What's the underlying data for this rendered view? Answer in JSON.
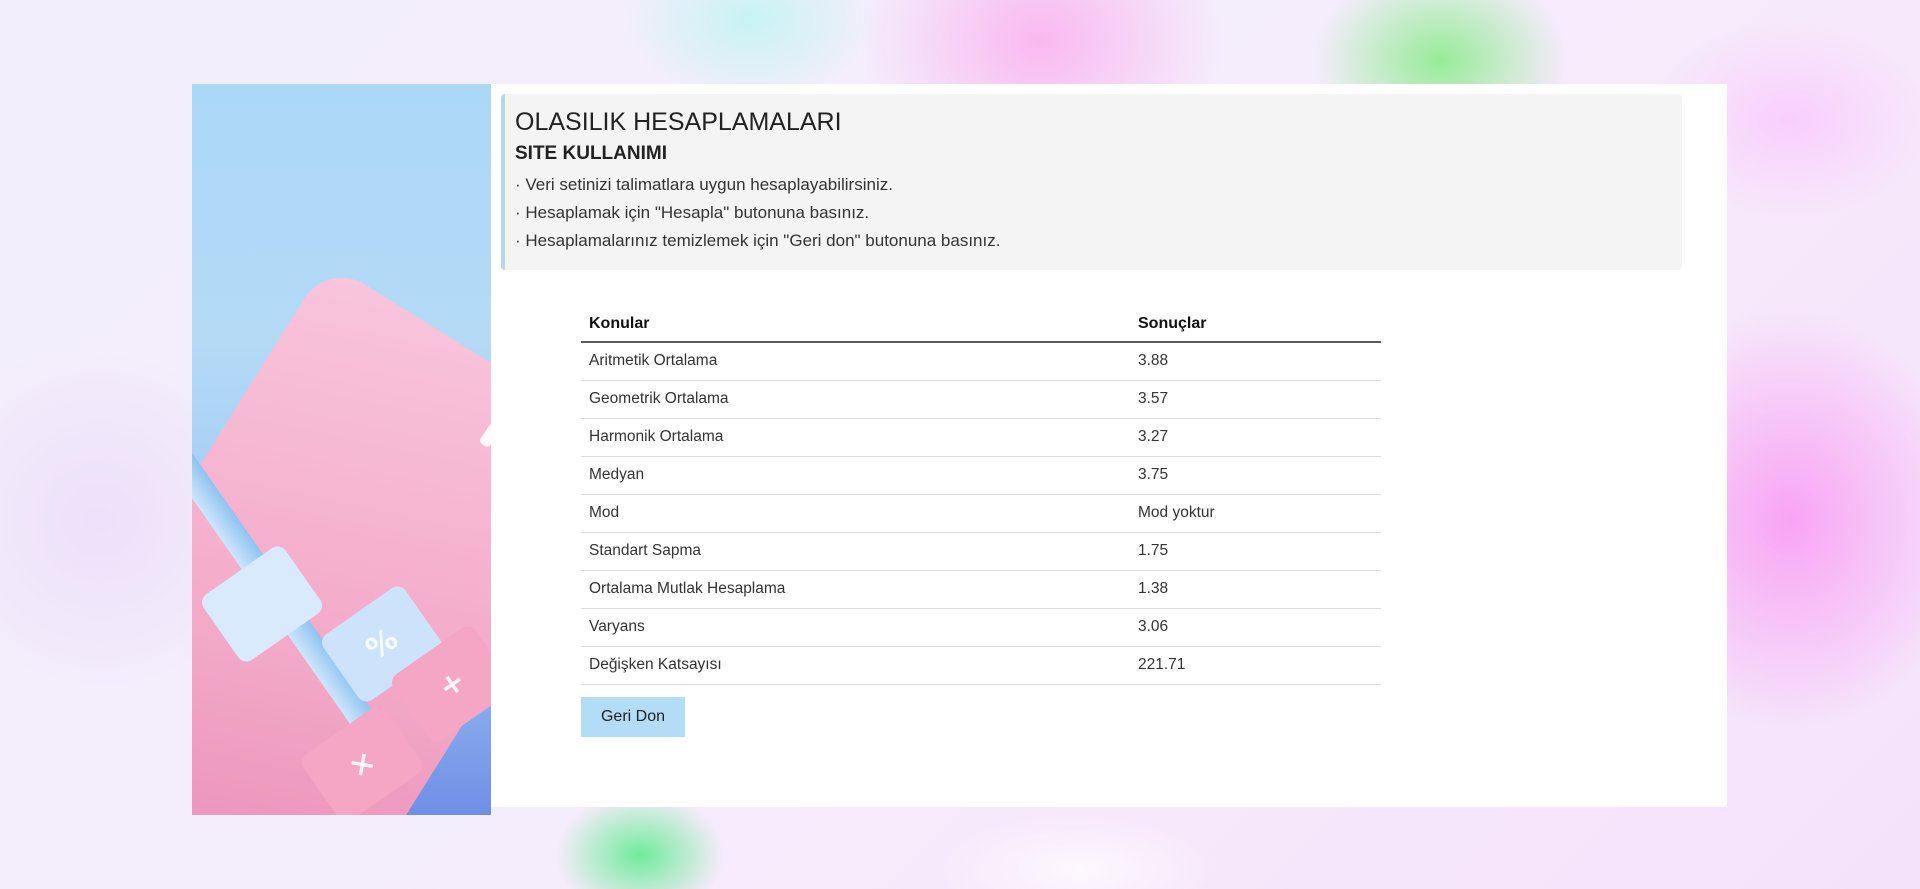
{
  "info": {
    "title": "OLASILIK HESAPLAMALARI",
    "subtitle": "SITE KULLANIMI",
    "lines": [
      "· Veri setinizi talimatlara uygun hesaplayabilirsiniz.",
      "· Hesaplamak için \"Hesapla\" butonuna basınız.",
      "· Hesaplamalarınız temizlemek için \"Geri don\" butonuna basınız."
    ]
  },
  "table": {
    "headers": [
      "Konular",
      "Sonuçlar"
    ],
    "rows": [
      [
        "Aritmetik Ortalama",
        "3.88"
      ],
      [
        "Geometrik Ortalama",
        "3.57"
      ],
      [
        "Harmonik Ortalama",
        "3.27"
      ],
      [
        "Medyan",
        "3.75"
      ],
      [
        "Mod",
        "Mod yoktur"
      ],
      [
        "Standart Sapma",
        "1.75"
      ],
      [
        "Ortalama Mutlak Hesaplama",
        "1.38"
      ],
      [
        "Varyans",
        "3.06"
      ],
      [
        "Değişken Katsayısı",
        "221.71"
      ]
    ]
  },
  "back_button": {
    "label": "Geri Don"
  },
  "side_image": {
    "key_symbols": [
      "%",
      "+",
      "×",
      "="
    ]
  },
  "colors": {
    "button": "#b3dcf6",
    "info_border": "#b8d7ef",
    "info_bg": "#f4f4f4"
  }
}
